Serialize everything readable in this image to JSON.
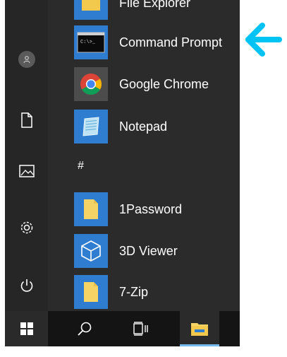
{
  "apps": [
    {
      "label": "File Explorer",
      "icon": "folder-icon",
      "tile_color": "#2f7dd1"
    },
    {
      "label": "Command Prompt",
      "icon": "cmd-icon",
      "tile_color": "#2f7dd1"
    },
    {
      "label": "Google Chrome",
      "icon": "chrome-icon",
      "tile_color": "#4c4c4c"
    },
    {
      "label": "Notepad",
      "icon": "notepad-icon",
      "tile_color": "#2f7dd1"
    },
    {
      "label": "1Password",
      "icon": "folder-icon",
      "tile_color": "#2f7dd1"
    },
    {
      "label": "3D Viewer",
      "icon": "cube-icon",
      "tile_color": "#2f7dd1"
    },
    {
      "label": "7-Zip",
      "icon": "folder-icon",
      "tile_color": "#2f7dd1"
    }
  ],
  "section_letter": "#",
  "rail": [
    "user-avatar",
    "documents-icon",
    "pictures-icon",
    "settings-icon",
    "power-icon"
  ],
  "taskbar": [
    "windows-start-icon",
    "search-icon",
    "task-view-icon",
    "file-explorer-icon"
  ],
  "accent": "#00c3f5"
}
